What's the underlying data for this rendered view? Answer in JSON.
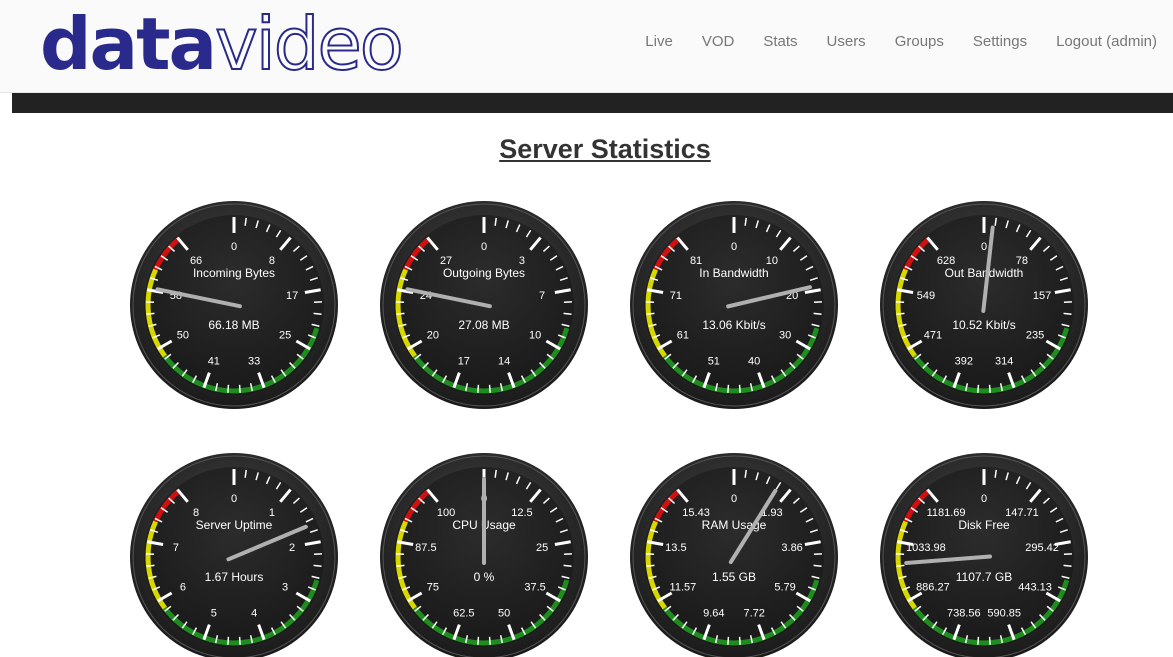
{
  "logo": {
    "part1": "data",
    "part2": "video"
  },
  "nav": [
    "Live",
    "VOD",
    "Stats",
    "Users",
    "Groups",
    "Settings",
    "Logout (admin)"
  ],
  "page_title": "Server Statistics",
  "gauges": [
    {
      "name": "incoming-bytes",
      "title": "Incoming Bytes",
      "value_text": "66.18 MB",
      "labels": [
        "0",
        "8",
        "17",
        "25",
        "33",
        "41",
        "50",
        "58",
        "66"
      ],
      "needle_fraction": 0.88
    },
    {
      "name": "outgoing-bytes",
      "title": "Outgoing Bytes",
      "value_text": "27.08 MB",
      "labels": [
        "0",
        "3",
        "7",
        "10",
        "14",
        "17",
        "20",
        "24",
        "27"
      ],
      "needle_fraction": 0.88
    },
    {
      "name": "in-bandwidth",
      "title": "In Bandwidth",
      "value_text": "13.06 Kbit/s",
      "labels": [
        "0",
        "10",
        "20",
        "30",
        "40",
        "51",
        "61",
        "71",
        "81"
      ],
      "needle_fraction": 0.24
    },
    {
      "name": "out-bandwidth",
      "title": "Out Bandwidth",
      "value_text": "10.52 Kbit/s",
      "labels": [
        "0",
        "78",
        "157",
        "235",
        "314",
        "392",
        "471",
        "549",
        "628"
      ],
      "needle_fraction": 0.02
    },
    {
      "name": "server-uptime",
      "title": "Server Uptime",
      "value_text": "1.67 Hours",
      "labels": [
        "0",
        "1",
        "2",
        "3",
        "4",
        "5",
        "6",
        "7",
        "8"
      ],
      "needle_fraction": 0.21
    },
    {
      "name": "cpu-usage",
      "title": "CPU Usage",
      "value_text": "0 %",
      "labels": [
        "0",
        "12.5",
        "25",
        "37.5",
        "50",
        "62.5",
        "75",
        "87.5",
        "100"
      ],
      "needle_fraction": 0.0
    },
    {
      "name": "ram-usage",
      "title": "RAM Usage",
      "value_text": "1.55 GB",
      "labels": [
        "0",
        "1.93",
        "3.86",
        "5.79",
        "7.72",
        "9.64",
        "11.57",
        "13.5",
        "15.43"
      ],
      "needle_fraction": 0.1
    },
    {
      "name": "disk-free",
      "title": "Disk Free",
      "value_text": "1107.7 GB",
      "labels": [
        "0",
        "147.71",
        "295.42",
        "443.13",
        "590.85",
        "738.56",
        "886.27",
        "1033.98",
        "1181.69"
      ],
      "needle_fraction": 0.83
    }
  ],
  "colors": {
    "dial": "#222222",
    "bezel": "#2e2e2e",
    "needle": "#b0b0b0",
    "zone_green": "#1e8c1e",
    "zone_yellow": "#d8d800",
    "zone_red": "#d01010",
    "logo_blue": "#2a2a8c",
    "nav_text": "#777777"
  }
}
